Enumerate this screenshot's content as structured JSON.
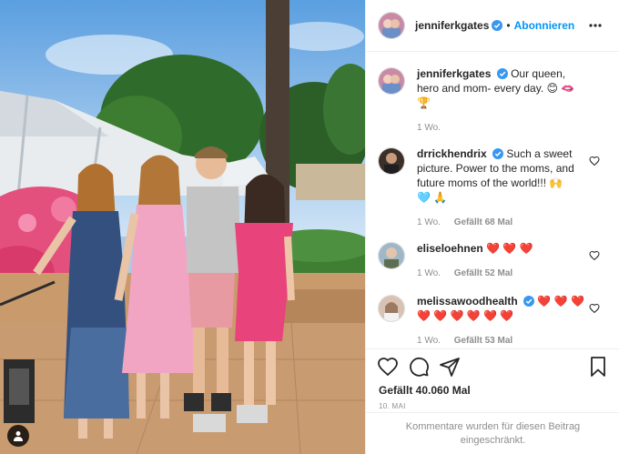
{
  "header": {
    "username": "jenniferkgates",
    "separator": "•",
    "follow_label": "Abonnieren"
  },
  "caption": {
    "username": "jenniferkgates",
    "text": "Our queen, hero and mom- every day. 😊 🫦 🏆",
    "time": "1 Wo."
  },
  "comments": [
    {
      "username": "drrickhendrix",
      "text": "Such a sweet picture. Power to the moms, and future moms of the world!!! 🙌",
      "emoji_line": "🩵 🙏",
      "time": "1 Wo.",
      "likes": "Gefällt 68 Mal"
    },
    {
      "username": "eliseloehnen",
      "text": "❤️ ❤️ ❤️",
      "time": "1 Wo.",
      "likes": "Gefällt 52 Mal"
    },
    {
      "username": "melissawoodhealth",
      "text": "❤️ ❤️ ❤️",
      "emoji_line": "❤️ ❤️ ❤️ ❤️ ❤️ ❤️",
      "time": "1 Wo.",
      "likes": "Gefällt 53 Mal"
    }
  ],
  "footer": {
    "likes": "Gefällt 40.060 Mal",
    "date": "10. MAI",
    "comments_closed": "Kommentare wurden für diesen Beitrag eingeschränkt."
  },
  "colors": {
    "accent": "#0095f6",
    "verified": "#3897f0",
    "muted": "#8e8e8e",
    "text": "#262626"
  },
  "icons": [
    "verified-badge-icon",
    "more-options-icon",
    "heart-icon",
    "comment-icon",
    "share-icon",
    "bookmark-icon",
    "user-tag-icon"
  ]
}
